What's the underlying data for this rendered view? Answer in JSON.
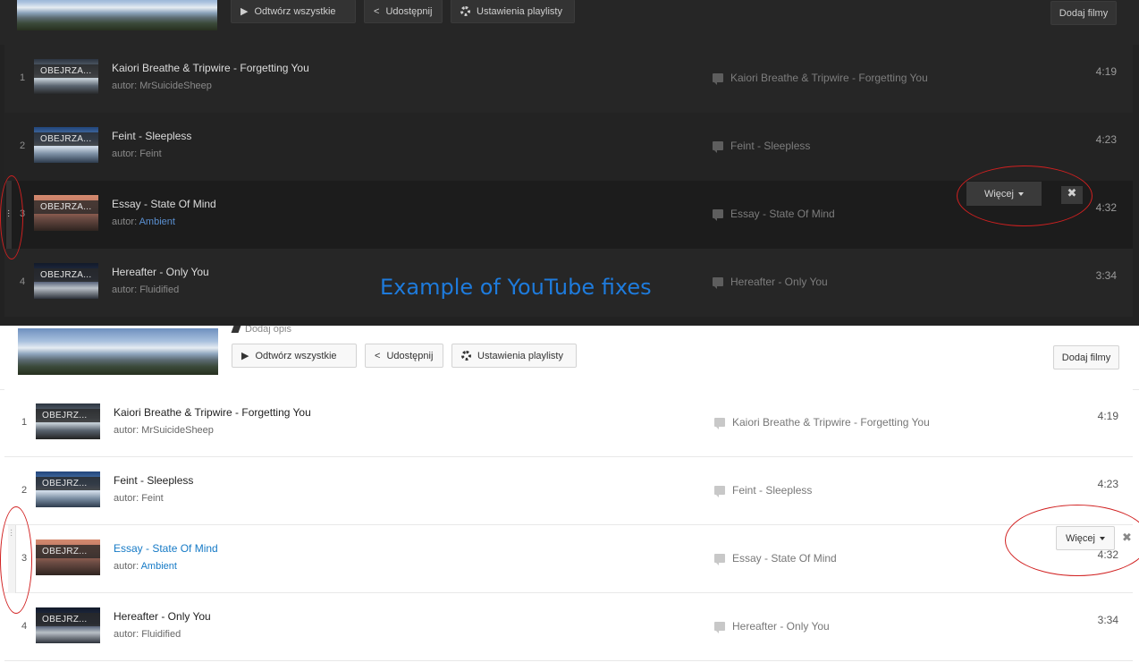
{
  "caption": "Example of YouTube fixes",
  "header": {
    "add_description": "Dodaj opis",
    "play_all": "Odtwórz wszystkie",
    "share": "Udostępnij",
    "playlist_settings": "Ustawienia playlisty",
    "add_videos": "Dodaj filmy"
  },
  "row_controls": {
    "more": "Więcej",
    "delete_glyph": "✖"
  },
  "author_prefix": "autor:",
  "badge": "OBEJRZA...",
  "badge_light": "OBEJRZ...",
  "videos": [
    {
      "index": "1",
      "title": "Kaiori Breathe & Tripwire - Forgetting You",
      "author": "MrSuicideSheep",
      "note": "Kaiori Breathe & Tripwire - Forgetting You",
      "duration": "4:19"
    },
    {
      "index": "2",
      "title": "Feint - Sleepless",
      "author": "Feint",
      "note": "Feint - Sleepless",
      "duration": "4:23"
    },
    {
      "index": "3",
      "title": "Essay - State Of Mind",
      "author": "Ambient",
      "note": "Essay - State Of Mind",
      "duration": "4:32"
    },
    {
      "index": "4",
      "title": "Hereafter - Only You",
      "author": "Fluidified",
      "note": "Hereafter - Only You",
      "duration": "3:34"
    }
  ],
  "colors": {
    "dark_bg": "#222222",
    "light_bg": "#ffffff",
    "link_dark": "#5a8fd0",
    "link_light": "#167ac6",
    "annotation_red": "#d12020",
    "caption_blue": "#1e7bdc"
  }
}
